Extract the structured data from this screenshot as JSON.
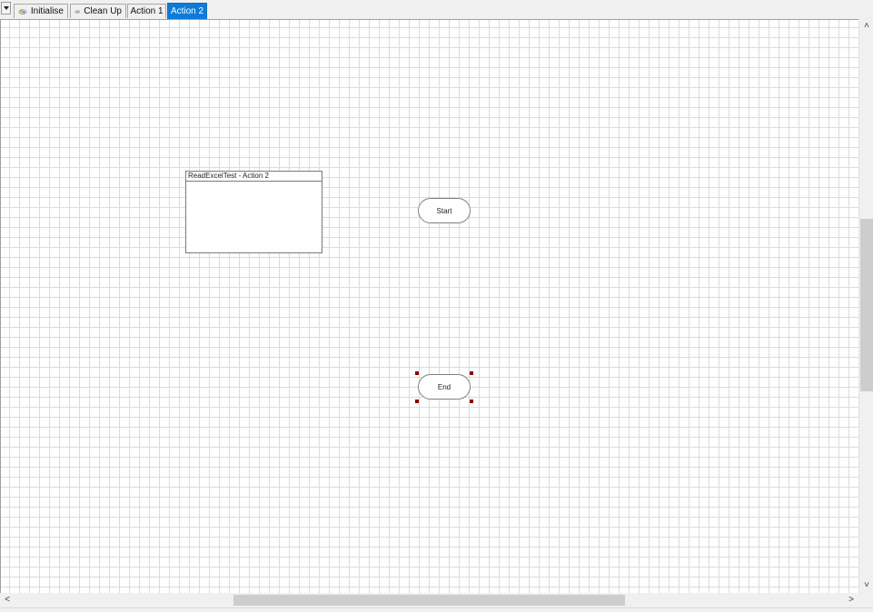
{
  "tabs": [
    {
      "label": "Initialise",
      "icon": "process-gear-icon",
      "active": false
    },
    {
      "label": "Clean Up",
      "icon": "process-gear-icon",
      "active": false
    },
    {
      "label": "Action 1",
      "active": false
    },
    {
      "label": "Action 2",
      "active": true
    }
  ],
  "canvas": {
    "page_frame_title": "ReadExcelTest - Action 2",
    "start_label": "Start",
    "end_label": "End",
    "selected_node": "End"
  },
  "scrollbars": {
    "up_glyph": "˄",
    "down_glyph": "˅",
    "left_glyph": "<",
    "right_glyph": ">"
  },
  "colors": {
    "active_tab": "#0f7bd8",
    "grid": "#dcdcdc",
    "selection_handle": "#8b0000"
  }
}
